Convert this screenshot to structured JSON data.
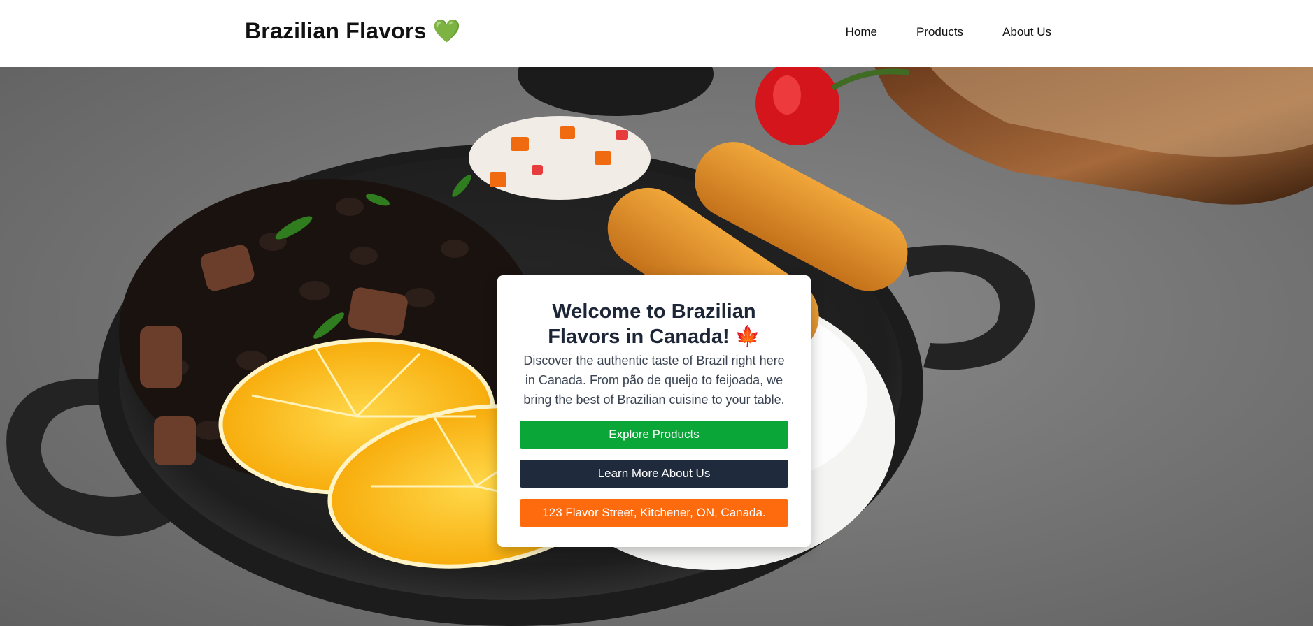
{
  "header": {
    "brand": "Brazilian Flavors 💚",
    "nav": [
      {
        "label": "Home"
      },
      {
        "label": "Products"
      },
      {
        "label": "About Us"
      }
    ]
  },
  "hero": {
    "image_subject": "feijoada-plate",
    "card": {
      "title": "Welcome to Brazilian Flavors in Canada! 🍁",
      "description": "Discover the authentic taste of Brazil right here in Canada. From pão de queijo to feijoada, we bring the best of Brazilian cuisine to your table.",
      "buttons": {
        "explore": "Explore Products",
        "about": "Learn More About Us",
        "address": "123 Flavor Street, Kitchener, ON, Canada."
      }
    }
  },
  "colors": {
    "green": "#0aa638",
    "dark": "#1f2a3c",
    "orange": "#fe6a0e"
  }
}
